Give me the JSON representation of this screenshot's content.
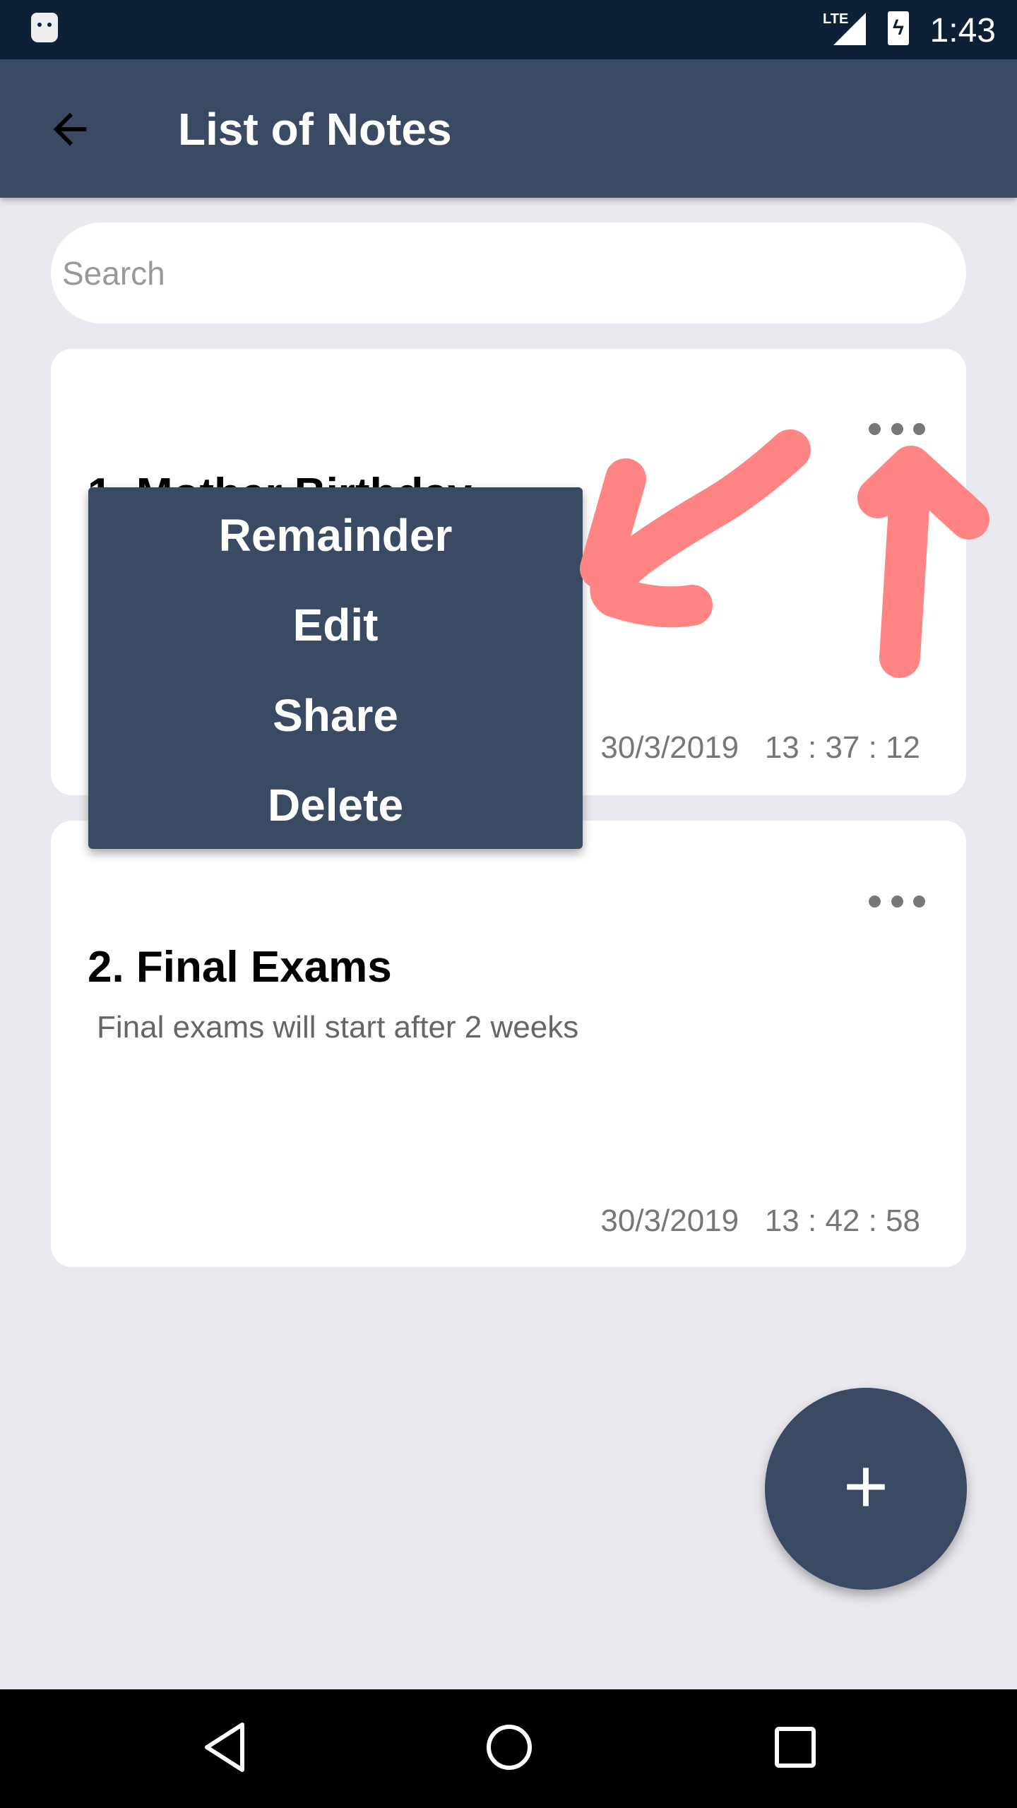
{
  "status_bar": {
    "network": "LTE",
    "time": "1:43",
    "icons": [
      "android-debug-icon",
      "signal-icon",
      "battery-charging-icon"
    ]
  },
  "app_bar": {
    "title": "List of Notes",
    "back_icon": "arrow-left-icon"
  },
  "search": {
    "placeholder": "Search",
    "value": ""
  },
  "notes": [
    {
      "title": "1. Mother Birthday",
      "body": "",
      "date": "30/3/2019",
      "time": "13 : 37 : 12"
    },
    {
      "title": "2. Final Exams",
      "body": "Final exams will start after 2 weeks",
      "date": "30/3/2019",
      "time": "13 : 42 : 58"
    }
  ],
  "context_menu": {
    "items": [
      "Remainder",
      "Edit",
      "Share",
      "Delete"
    ]
  },
  "fab": {
    "label": "+",
    "icon": "plus-icon"
  },
  "annotation_color": "#ff8585",
  "colors": {
    "primary": "#3a4a62",
    "status_bar": "#0e2036",
    "background": "#e9e9ef"
  }
}
